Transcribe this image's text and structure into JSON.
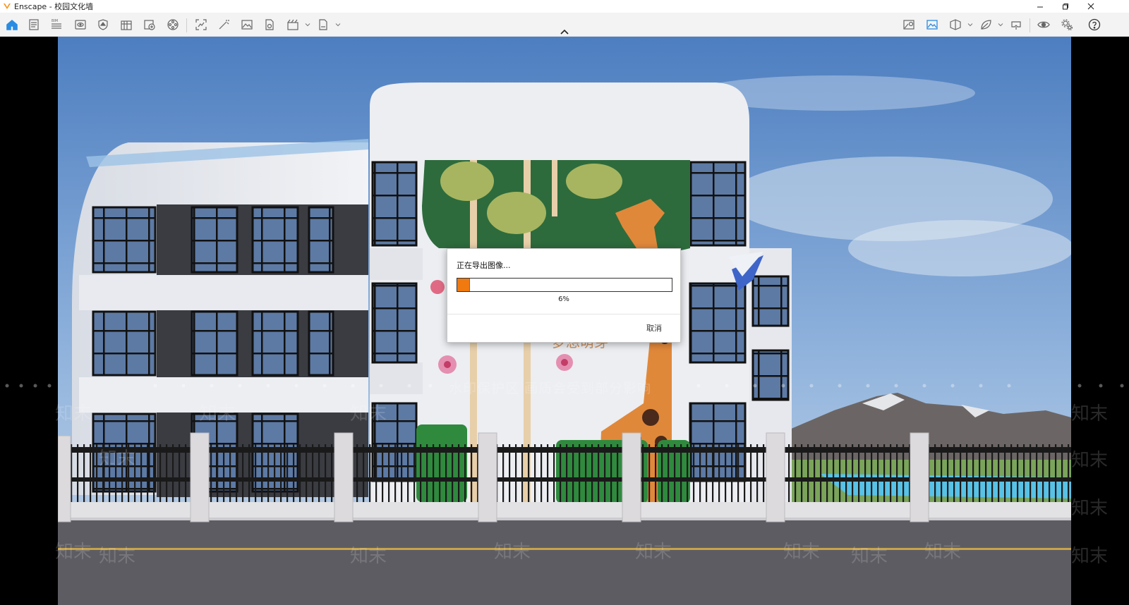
{
  "window": {
    "app_name": "Enscape - 校园文化墙",
    "controls": [
      "minimize-icon",
      "restore-icon",
      "close-icon"
    ]
  },
  "toolbar": {
    "left_icons": [
      "home-icon",
      "document-icon",
      "bim-list-icon",
      "eye-preview-icon",
      "shield-icon",
      "library-icon",
      "add-asset-icon",
      "film-reel-icon",
      "screenshot-frame-icon",
      "magic-wand-icon",
      "image-icon",
      "batch-render-icon",
      "video-editor-icon",
      "export-file-icon"
    ],
    "right_icons": [
      "map-icon",
      "landscape-view-icon",
      "cube-section-icon",
      "leaf-icon",
      "vr-headset-icon",
      "eye-visibility-icon",
      "settings-gears-icon",
      "help-icon"
    ],
    "active_icons": [
      "home-icon",
      "landscape-view-icon"
    ],
    "accent_color": "#2a8be3",
    "bim_label": "BIM"
  },
  "viewport": {
    "scene": "rendered school building facade with giraffe mural and fence",
    "watermark_text": "知末",
    "banner_text": "水印保护区 画质会受到部分影响"
  },
  "export_dialog": {
    "title": "正在导出图像...",
    "progress_percent": 6,
    "progress_label": "6%",
    "cancel_label": "取消",
    "progress_color": "#f07a10"
  }
}
